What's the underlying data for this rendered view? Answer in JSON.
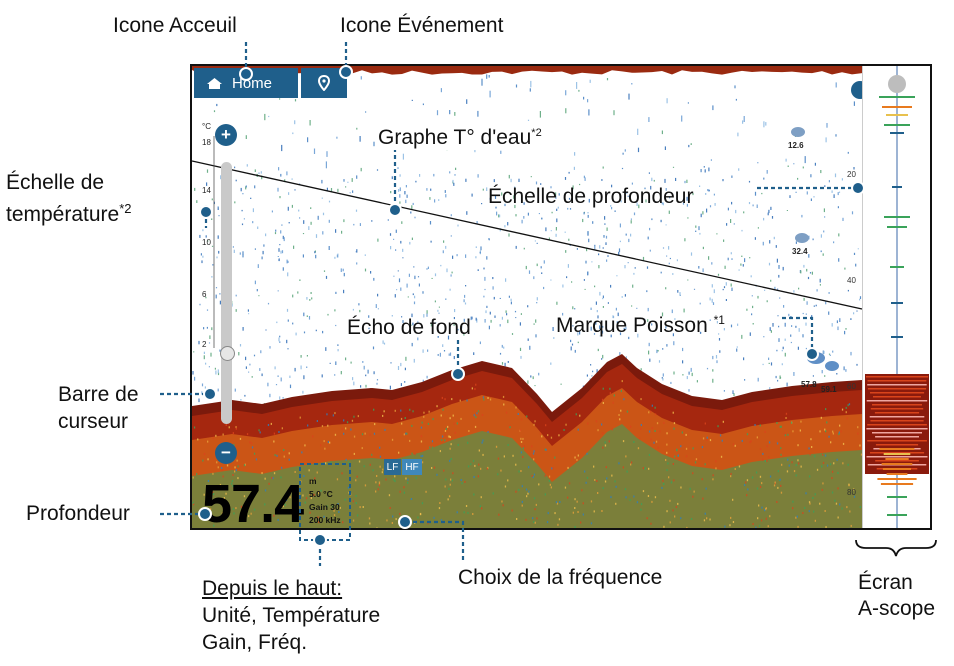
{
  "screen": {
    "home_label": "Home",
    "temp_scale_unit": "°C",
    "temp_ticks": [
      "18",
      "14",
      "10",
      "6",
      "2"
    ],
    "depth_ticks": [
      "20",
      "40",
      "60",
      "80"
    ],
    "depth_value": "57.4",
    "info_lines": [
      "m",
      "5.0 °C",
      "Gain 30",
      "200 kHz"
    ],
    "freq_lf": "LF",
    "freq_hf": "HF",
    "fish_marks": [
      "12.6",
      "32.4",
      "57.8",
      "59.1"
    ],
    "cursor_plus": "+",
    "cursor_minus": "−"
  },
  "annotations": {
    "home_icon": "Icone Acceuil",
    "event_icon": "Icone Événement",
    "water_temp_graph": "Graphe T° d'eau",
    "water_temp_graph_sup": "*2",
    "temp_scale_l1": "Échelle de",
    "temp_scale_l2": "température",
    "temp_scale_sup": "*2",
    "depth_scale": "Échelle de profondeur",
    "bottom_echo": "Écho de fond",
    "fish_mark": "Marque Poisson",
    "fish_mark_sup": "*1",
    "cursor_bar_l1": "Barre de",
    "cursor_bar_l2": "curseur",
    "depth": "Profondeur",
    "freq_choice": "Choix de la fréquence",
    "ascope_l1": "Écran",
    "ascope_l2": "A-scope",
    "from_top_title": "Depuis le haut:",
    "from_top_l1": "Unité, Température",
    "from_top_l2": "Gain, Fréq."
  },
  "colors": {
    "button_blue": "#1f5f8b",
    "bottom_dark": "#7b1a0c",
    "bottom_red": "#b52a12",
    "orange": "#e87a1e",
    "green": "#3aa35a",
    "leader": "#1f5f8b"
  }
}
